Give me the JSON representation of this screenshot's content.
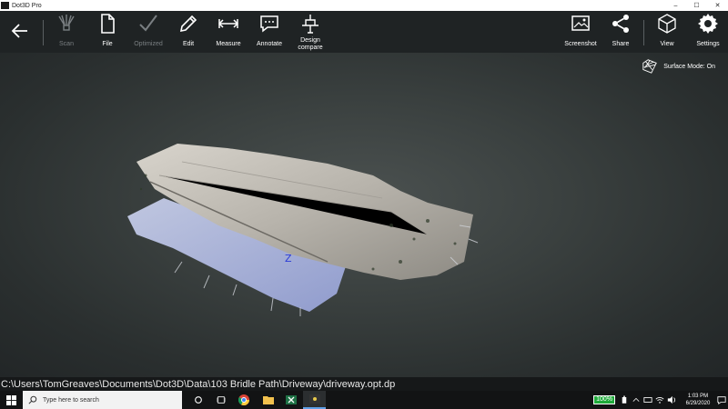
{
  "window": {
    "title": "Dot3D Pro",
    "controls": [
      "–",
      "☐",
      "✕"
    ]
  },
  "toolbar": {
    "back_icon": "arrow-left-icon",
    "items": [
      {
        "label": "Scan",
        "icon": "scan-icon",
        "enabled": false
      },
      {
        "label": "File",
        "icon": "file-icon",
        "enabled": true
      },
      {
        "label": "Optimized",
        "icon": "checkmark-icon",
        "enabled": false
      },
      {
        "label": "Edit",
        "icon": "pencil-icon",
        "enabled": true
      },
      {
        "label": "Measure",
        "icon": "measure-icon",
        "enabled": true
      },
      {
        "label": "Annotate",
        "icon": "speech-bubble-icon",
        "enabled": true
      },
      {
        "label": "Design compare",
        "line1": "Design",
        "line2": "compare",
        "icon": "design-compare-icon",
        "enabled": true
      }
    ],
    "right_items": [
      {
        "label": "Screenshot",
        "icon": "screenshot-icon"
      },
      {
        "label": "Share",
        "icon": "share-icon"
      },
      {
        "label": "View",
        "icon": "cube-icon"
      },
      {
        "label": "Settings",
        "icon": "gear-icon"
      }
    ]
  },
  "viewport": {
    "surface_mode_label": "Surface Mode: On",
    "surface_mode_icon": "surface-mesh-icon",
    "axis_label": "Z",
    "axis_color": "#2a3bd6"
  },
  "pathbar": {
    "path": "C:\\Users\\TomGreaves\\Documents\\Dot3D\\Data\\103 Bridle Path\\Driveway\\driveway.opt.dp"
  },
  "taskbar": {
    "search_placeholder": "Type here to search",
    "apps": [
      "cortana-icon",
      "task-view-icon",
      "chrome-icon",
      "file-explorer-icon",
      "excel-icon",
      "dot3d-icon"
    ],
    "battery": "100%",
    "time": "1:03 PM",
    "date": "6/29/2020"
  }
}
